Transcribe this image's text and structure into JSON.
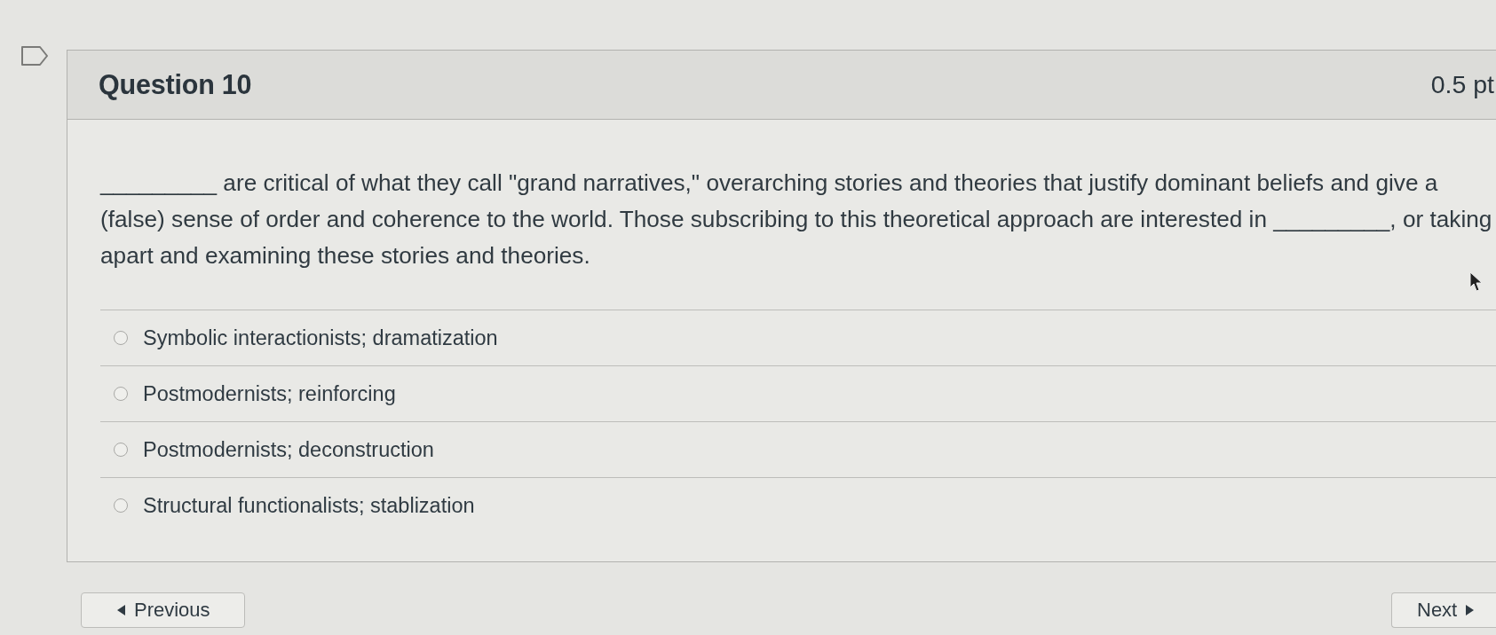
{
  "question": {
    "flagged": false,
    "title": "Question 10",
    "points": "0.5 pt",
    "text": "_________ are critical of what they call \"grand narratives,\" overarching stories and theories that justify dominant beliefs and give a (false) sense of order and coherence to the world. Those subscribing to this theoretical approach are interested in _________, or taking apart and examining these stories and theories.",
    "answers": [
      {
        "label": "Symbolic interactionists; dramatization",
        "selected": false
      },
      {
        "label": "Postmodernists; reinforcing",
        "selected": false
      },
      {
        "label": "Postmodernists; deconstruction",
        "selected": false
      },
      {
        "label": "Structural functionalists; stablization",
        "selected": false
      }
    ]
  },
  "navigation": [
    {
      "kind": "previous",
      "label": "Previous"
    },
    {
      "kind": "next",
      "label": "Next"
    }
  ]
}
